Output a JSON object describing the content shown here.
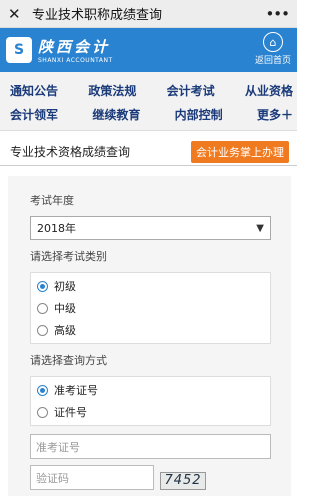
{
  "window": {
    "title": "专业技术职称成绩查询",
    "close_icon": "close-icon",
    "more_icon": "more-icon"
  },
  "banner": {
    "logo_cn": "陕西会计",
    "logo_en": "SHANXI ACCOUNTANT",
    "home_label": "返回首页",
    "home_icon": "home-icon",
    "brand_color": "#2a83d0"
  },
  "nav": {
    "row1": [
      "通知公告",
      "政策法规",
      "会计考试",
      "从业资格"
    ],
    "row2": [
      "会计领军",
      "继续教育",
      "内部控制",
      "更多＋"
    ]
  },
  "section": {
    "title": "专业技术资格成绩查询",
    "cta": "会计业务掌上办理",
    "cta_color": "#f07a1f"
  },
  "form": {
    "year_label": "考试年度",
    "year_value": "2018年",
    "category_label": "请选择考试类别",
    "categories": [
      "初级",
      "中级",
      "高级"
    ],
    "category_selected": "初级",
    "method_label": "请选择查询方式",
    "methods": [
      "准考证号",
      "证件号"
    ],
    "method_selected": "准考证号",
    "ticket_placeholder": "准考证号",
    "captcha_placeholder": "验证码",
    "captcha_text": "7452"
  }
}
